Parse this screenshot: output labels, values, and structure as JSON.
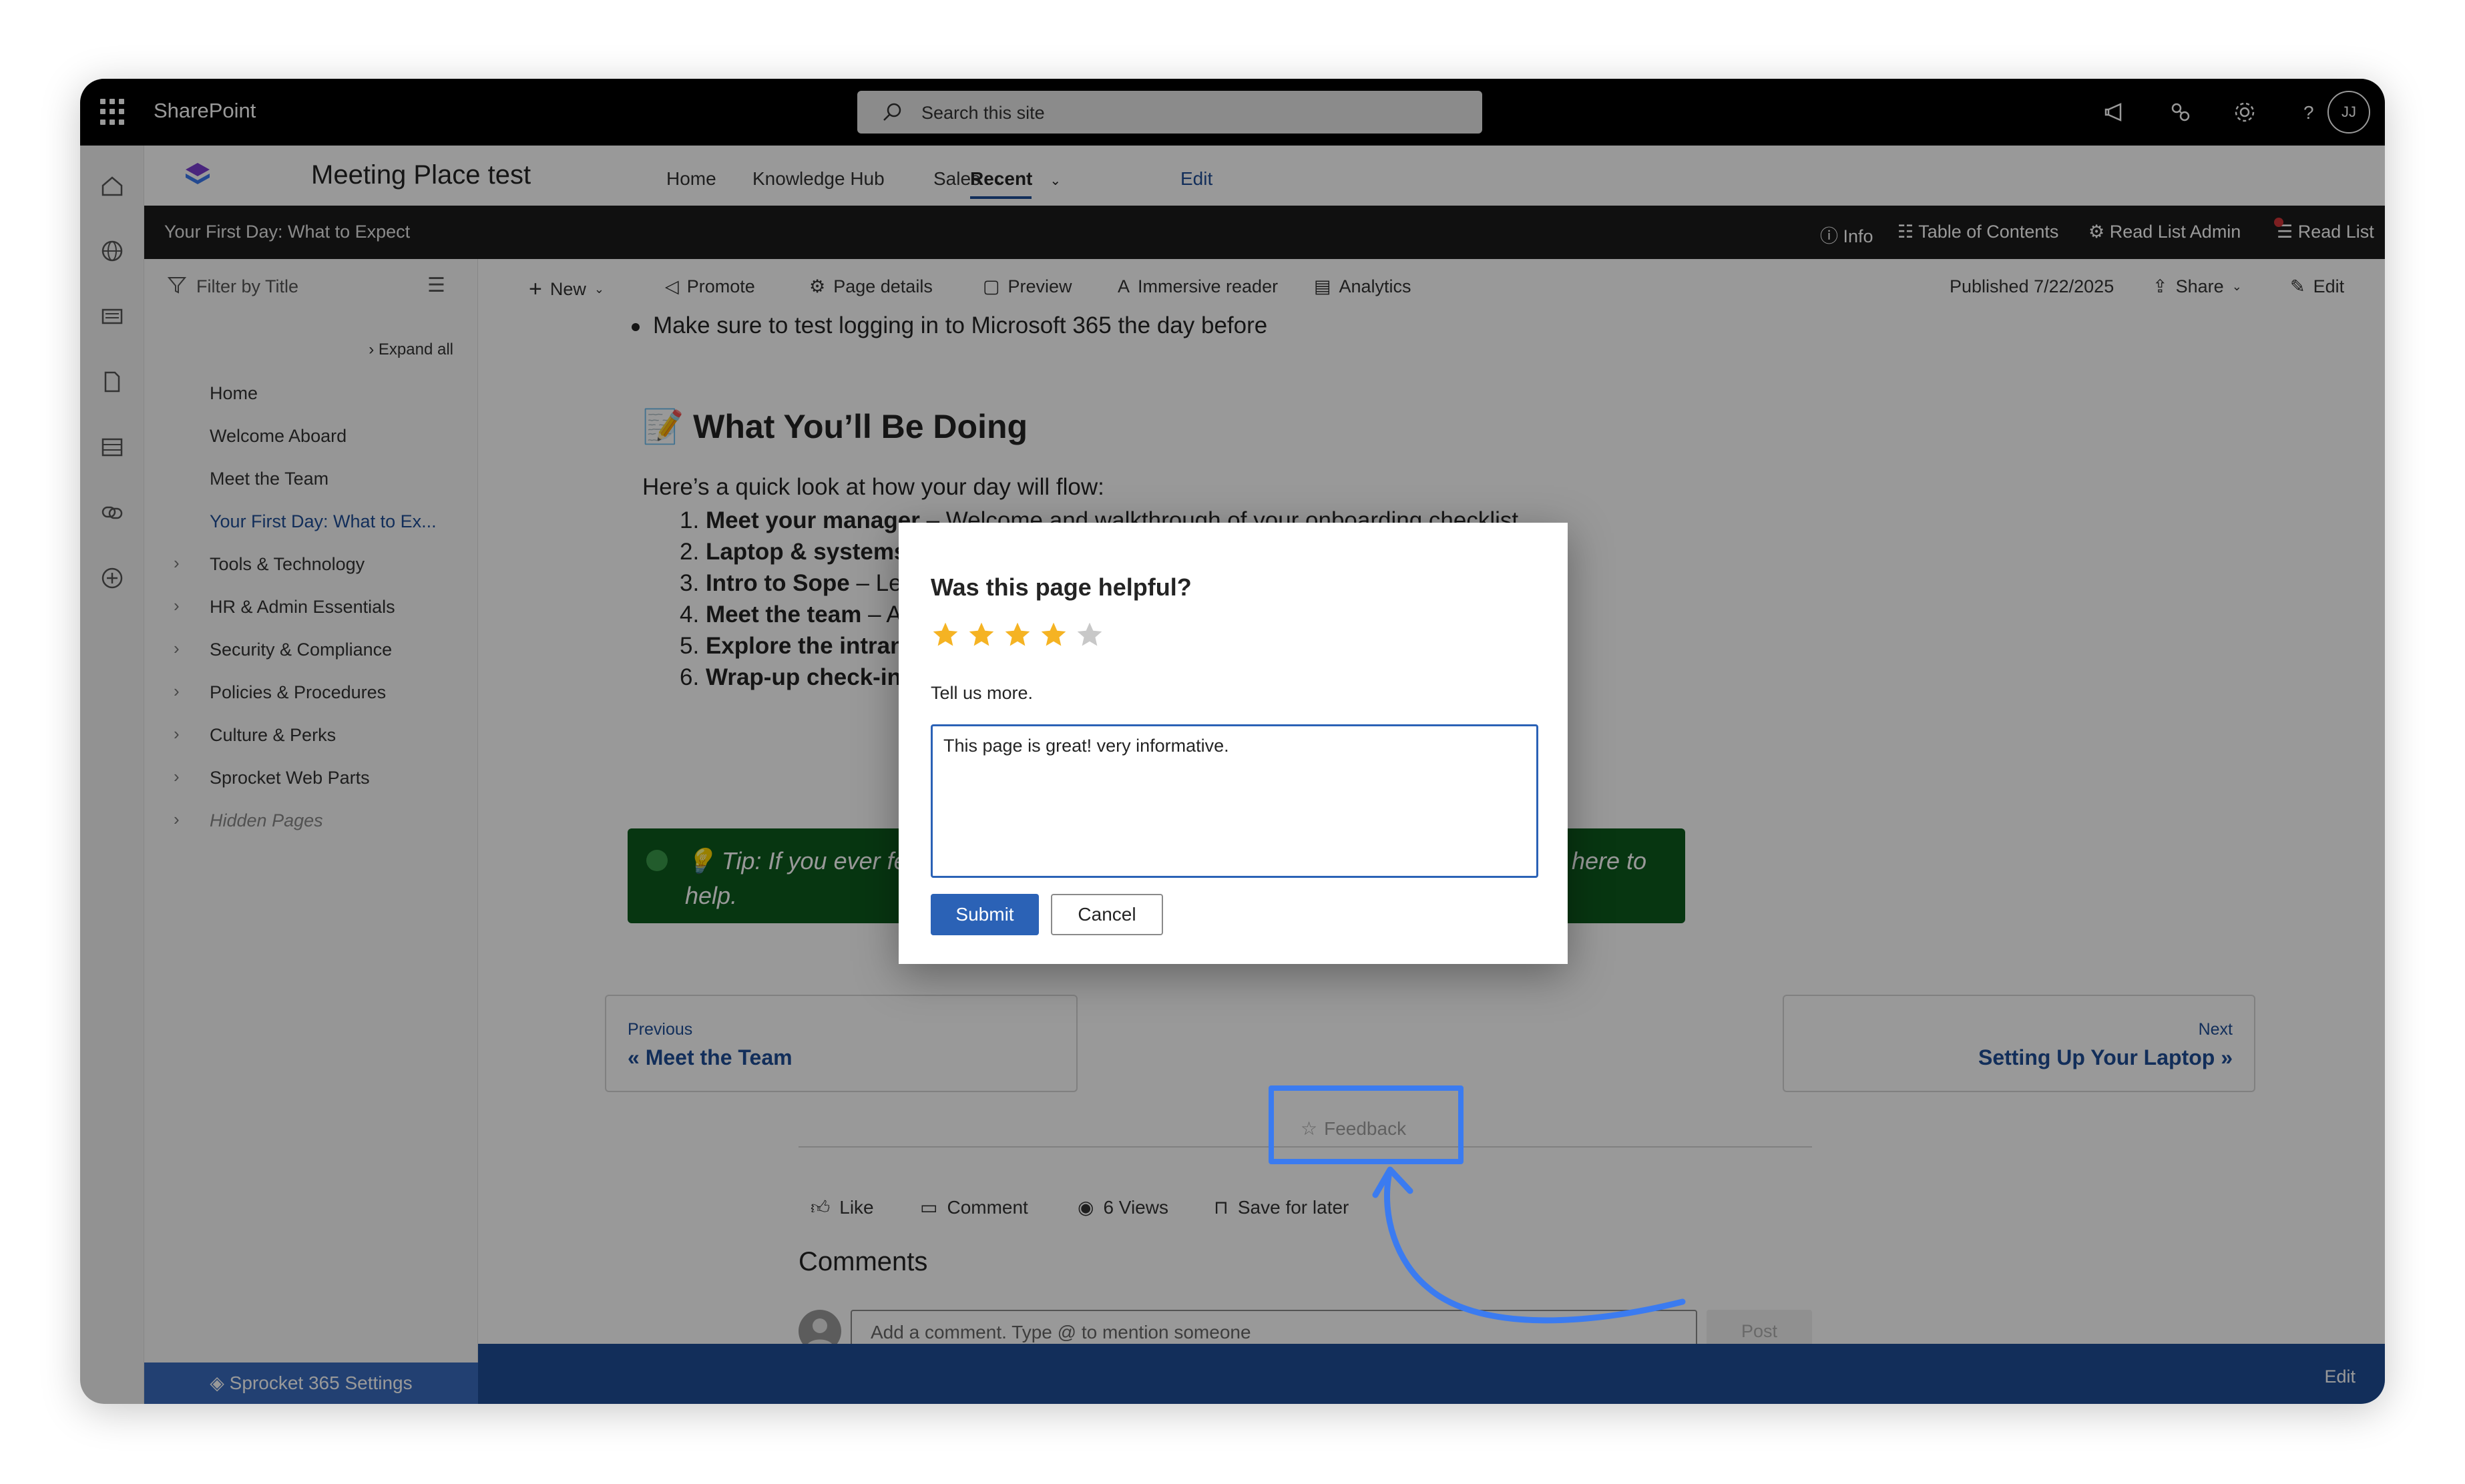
{
  "suite": {
    "brand": "SharePoint",
    "search_placeholder": "Search this site",
    "avatar_initials": "JJ"
  },
  "site": {
    "title": "Meeting Place test",
    "nav": [
      {
        "label": "Home"
      },
      {
        "label": "Knowledge Hub"
      },
      {
        "label": "Sales"
      },
      {
        "label": "Recent"
      },
      {
        "label": "Edit"
      }
    ]
  },
  "pagebar": {
    "page_title": "Your First Day: What to Expect",
    "info": "Info",
    "toc": "Table of Contents",
    "read_list_admin": "Read List Admin",
    "read_list": "Read List"
  },
  "sidenav": {
    "filter_placeholder": "Filter by Title",
    "expand_all": "Expand all",
    "items": [
      {
        "label": "Home"
      },
      {
        "label": "Welcome Aboard"
      },
      {
        "label": "Meet the Team"
      },
      {
        "label": "Your First Day: What to Ex..."
      },
      {
        "label": "Tools & Technology"
      },
      {
        "label": "HR & Admin Essentials"
      },
      {
        "label": "Security & Compliance"
      },
      {
        "label": "Policies & Procedures"
      },
      {
        "label": "Culture & Perks"
      },
      {
        "label": "Sprocket Web Parts"
      },
      {
        "label": "Hidden Pages"
      }
    ],
    "settings_label": "Sprocket 365 Settings"
  },
  "commands": {
    "new": "New",
    "promote": "Promote",
    "page_details": "Page details",
    "preview": "Preview",
    "immersive_reader": "Immersive reader",
    "analytics": "Analytics",
    "published": "Published 7/22/2025",
    "share": "Share",
    "edit": "Edit"
  },
  "content": {
    "bullet": "Make sure to test logging in to Microsoft 365 the day before",
    "heading": "📝 What You’ll Be Doing",
    "intro": "Here’s a quick look at how your day will flow:",
    "steps": [
      {
        "num": "1.",
        "bold": "Meet your manager",
        "rest": " – Welcome and walkthrough of your onboarding checklist"
      },
      {
        "num": "2.",
        "bold": "Laptop & systems",
        "rest": ""
      },
      {
        "num": "3.",
        "bold": "Intro to Sope",
        "rest": " – Le"
      },
      {
        "num": "4.",
        "bold": "Meet the team",
        "rest": " – A"
      },
      {
        "num": "5.",
        "bold": "Explore the intran",
        "rest": ""
      },
      {
        "num": "6.",
        "bold": "Wrap-up check-in",
        "rest": ""
      }
    ],
    "tip_line1": "💡 Tip: If you ever fe",
    "tip_line1_end": "here to",
    "tip_line2": "help.",
    "previous_small": "Previous",
    "previous_big": "« Meet the Team",
    "next_small": "Next",
    "next_big": "Setting Up Your Laptop »"
  },
  "social": {
    "like": "Like",
    "comment": "Comment",
    "views": "6 Views",
    "save": "Save for later",
    "feedback": "Feedback"
  },
  "comments": {
    "heading": "Comments",
    "placeholder": "Add a comment. Type @ to mention someone",
    "post": "Post"
  },
  "footer": {
    "edit": "Edit"
  },
  "dialog": {
    "title": "Was this page helpful?",
    "rating": 4,
    "max_rating": 5,
    "label": "Tell us more.",
    "text": "This page is great! very informative.",
    "submit": "Submit",
    "cancel": "Cancel"
  },
  "colors": {
    "accent": "#2b62b6",
    "star_filled": "#f5b323",
    "star_empty": "#c8c8c8",
    "highlight": "#3b7bf0",
    "tip_bg": "#0d5a1d"
  }
}
